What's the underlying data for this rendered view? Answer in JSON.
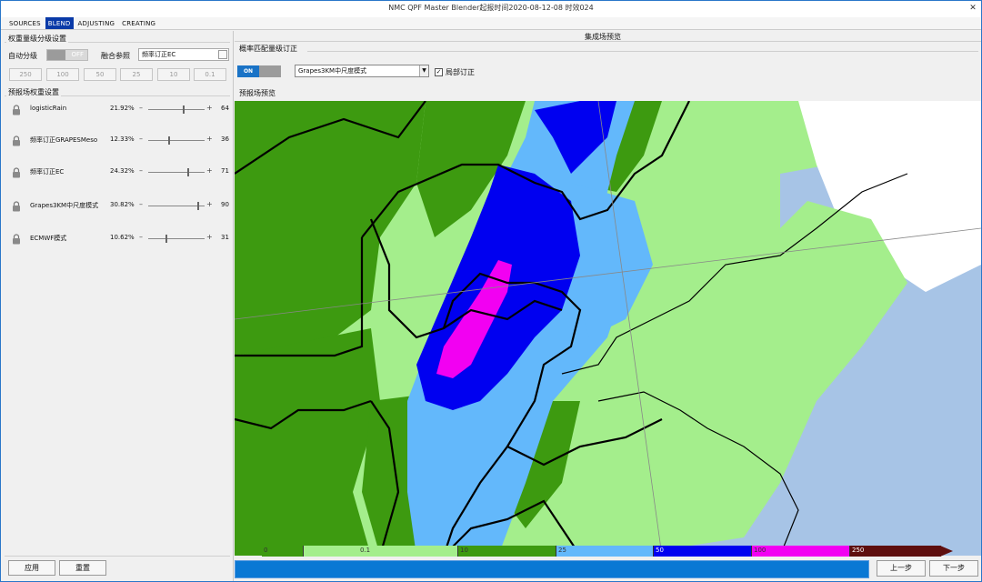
{
  "window": {
    "title": "NMC QPF Master Blender起报时间2020-08-12-08 时效024",
    "close": "✕"
  },
  "menu": [
    {
      "label": "SOURCES",
      "active": false
    },
    {
      "label": "BLEND",
      "active": true
    },
    {
      "label": "ADJUSTING",
      "active": false
    },
    {
      "label": "CREATING",
      "active": false
    }
  ],
  "left": {
    "grading_title": "权重量级分级设置",
    "auto_grade_label": "自动分级",
    "auto_grade_toggle": "OFF",
    "blend_ref_label": "融合参照",
    "blend_ref_value": "频率订正EC",
    "thresholds": [
      "250",
      "100",
      "50",
      "25",
      "10",
      "0.1"
    ],
    "weights_title": "预报场权重设置",
    "weights": [
      {
        "name": "logisticRain",
        "percent": "21.92%",
        "value": "64",
        "fraction": 0.64
      },
      {
        "name": "频率订正GRAPESMeso",
        "percent": "12.33%",
        "value": "36",
        "fraction": 0.36
      },
      {
        "name": "频率订正EC",
        "percent": "24.32%",
        "value": "71",
        "fraction": 0.71
      },
      {
        "name": "Grapes3KM中尺度模式",
        "percent": "30.82%",
        "value": "90",
        "fraction": 0.9
      },
      {
        "name": "ECMWF模式",
        "percent": "10.62%",
        "value": "31",
        "fraction": 0.31
      }
    ],
    "apply_button": "应用",
    "reset_button": "重置"
  },
  "right": {
    "preview_tab": "集成场预览",
    "freq_title": "概率匹配量级订正",
    "freq_toggle": "ON",
    "model_select": "Grapes3KM中尺度模式",
    "local_correct_checked": true,
    "local_correct_label": "局部订正",
    "preview_title": "预报场预览",
    "legend": [
      {
        "label": "0",
        "color": "#3d9a10"
      },
      {
        "label": "0.1",
        "color": "#a4ee8c"
      },
      {
        "label": "10",
        "color": "#3d9a10"
      },
      {
        "label": "25",
        "color": "#63b8fb"
      },
      {
        "label": "50",
        "color": "#0000f0"
      },
      {
        "label": "100",
        "color": "#f200f2"
      },
      {
        "label": "250",
        "color": "#5e0e0e"
      }
    ],
    "prev_button": "上一步",
    "next_button": "下一步"
  },
  "colors": {
    "accent": "#0a78d4",
    "rain_light": "#a4ee8c",
    "rain_moderate": "#3d9a10",
    "rain_heavy": "#63b8fb",
    "rain_storm": "#0000f0",
    "rain_extreme": "#f200f2",
    "sea": "#a7c4e6"
  }
}
